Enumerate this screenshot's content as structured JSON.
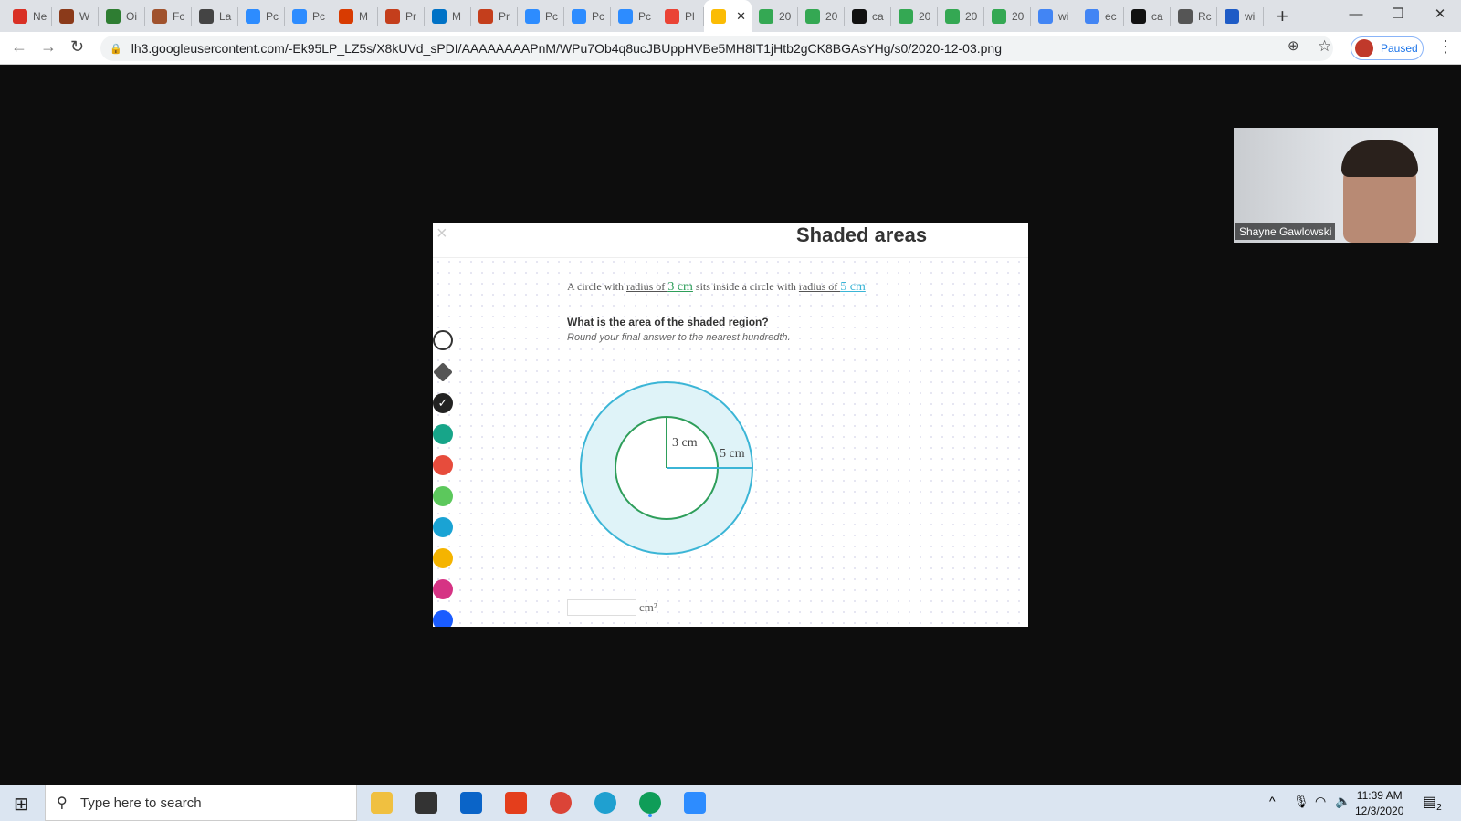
{
  "browser": {
    "tabs": [
      {
        "label": "Ne",
        "color": "#d93025"
      },
      {
        "label": "W",
        "color": "#8b3a1a"
      },
      {
        "label": "Oi",
        "color": "#2e7d32"
      },
      {
        "label": "Fc",
        "color": "#a0522d"
      },
      {
        "label": "La",
        "color": "#444444"
      },
      {
        "label": "Pc",
        "color": "#2d8cff"
      },
      {
        "label": "Pc",
        "color": "#2d8cff"
      },
      {
        "label": "M",
        "color": "#d83b01"
      },
      {
        "label": "Pr",
        "color": "#c43e1c"
      },
      {
        "label": "M",
        "color": "#0072c6"
      },
      {
        "label": "Pr",
        "color": "#c43e1c"
      },
      {
        "label": "Pc",
        "color": "#2d8cff"
      },
      {
        "label": "Pc",
        "color": "#2d8cff"
      },
      {
        "label": "Pc",
        "color": "#2d8cff"
      },
      {
        "label": "Pl",
        "color": "#ea4335"
      }
    ],
    "active_tab": {
      "label": "",
      "color": "#fbbc04",
      "close": "✕"
    },
    "tabs_after": [
      {
        "label": "20",
        "color": "#34a853"
      },
      {
        "label": "20",
        "color": "#34a853"
      },
      {
        "label": "ca",
        "color": "#111111"
      },
      {
        "label": "20",
        "color": "#34a853"
      },
      {
        "label": "20",
        "color": "#34a853"
      },
      {
        "label": "20",
        "color": "#34a853"
      },
      {
        "label": "wi",
        "color": "#4285f4"
      },
      {
        "label": "ec",
        "color": "#4285f4"
      },
      {
        "label": "ca",
        "color": "#111111"
      },
      {
        "label": "Rc",
        "color": "#555555"
      },
      {
        "label": "wi",
        "color": "#1e5bc6"
      }
    ],
    "url": "lh3.googleusercontent.com/-Ek95LP_LZ5s/X8kUVd_sPDI/AAAAAAAAPnM/WPu7Ob4q8ucJBUppHVBe5MH8IT1jHtb2gCK8BGAsYHg/s0/2020-12-03.png",
    "profile_status": "Paused"
  },
  "slide": {
    "title": "Shaded areas",
    "q_pre": "A circle with ",
    "q_radius1": "radius of ",
    "q_val1": "3 cm",
    "q_mid": " sits inside a circle with ",
    "q_radius2": "radius of ",
    "q_val2": "5 cm",
    "question": "What is the area of the shaded region?",
    "instruction": "Round your final answer to the nearest hundredth.",
    "label_inner": "3 cm",
    "label_outer": "5 cm",
    "unit": "cm²",
    "tool_colors": [
      "#17a589",
      "#e74c3c",
      "#5cc85c",
      "#1aa3d4",
      "#f5b400",
      "#d63384",
      "#1a5cff"
    ]
  },
  "webcam": {
    "name": "Shayne Gawlowski"
  },
  "taskbar": {
    "search_placeholder": "Type here to search",
    "time": "11:39 AM",
    "date": "12/3/2020",
    "notifications": "2"
  }
}
